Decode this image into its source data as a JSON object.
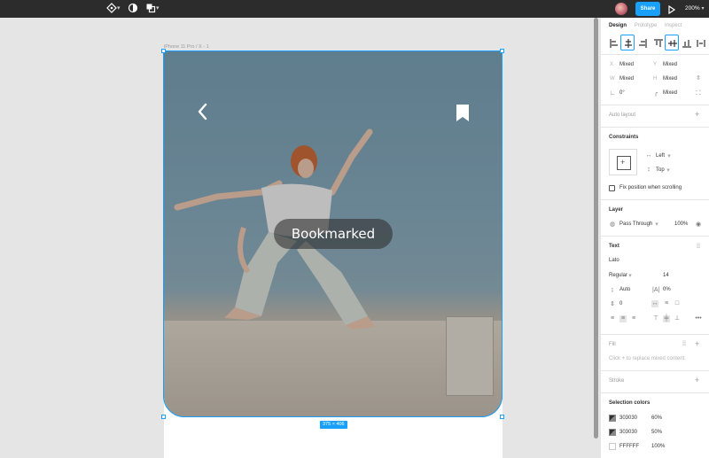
{
  "toolbar": {
    "share_label": "Share",
    "zoom_label": "200%",
    "icons": [
      "move-tool-icon",
      "contrast-icon",
      "shapes-icon",
      "avatar",
      "play-icon"
    ]
  },
  "canvas": {
    "frame_label": "iPhone 11 Pro / X - 1",
    "overlay_text": "Bookmarked",
    "size_badge": "375 × 406"
  },
  "panel": {
    "tabs": [
      {
        "label": "Design",
        "active": true
      },
      {
        "label": "Prototype",
        "active": false
      },
      {
        "label": "Inspect",
        "active": false
      }
    ],
    "geometry": {
      "x_label": "X",
      "x_value": "Mixed",
      "y_label": "Y",
      "y_value": "Mixed",
      "w_label": "W",
      "w_value": "Mixed",
      "h_label": "H",
      "h_value": "Mixed",
      "rotation_value": "0°",
      "radius_value": "Mixed"
    },
    "auto_layout": "Auto layout",
    "constraints": {
      "title": "Constraints",
      "horizontal": "Left",
      "vertical": "Top",
      "fix_position": "Fix position when scrolling"
    },
    "layer": {
      "title": "Layer",
      "blend": "Pass Through",
      "opacity": "100%"
    },
    "text": {
      "title": "Text",
      "font": "Lato",
      "weight": "Regular",
      "size": "14",
      "line_height": "Auto",
      "letter_spacing": "0%",
      "paragraph_spacing": "0"
    },
    "fill": {
      "title": "Fill",
      "hint": "Click + to replace mixed content."
    },
    "stroke": {
      "title": "Stroke"
    },
    "selection_colors": {
      "title": "Selection colors",
      "items": [
        {
          "hex": "303030",
          "opacity": "60%"
        },
        {
          "hex": "303030",
          "opacity": "50%"
        },
        {
          "hex": "FFFFFF",
          "opacity": "100%"
        }
      ]
    }
  },
  "colors": {
    "accent": "#18a0fb",
    "toolbar_bg": "#2c2c2c",
    "canvas_bg": "#e5e5e5"
  }
}
